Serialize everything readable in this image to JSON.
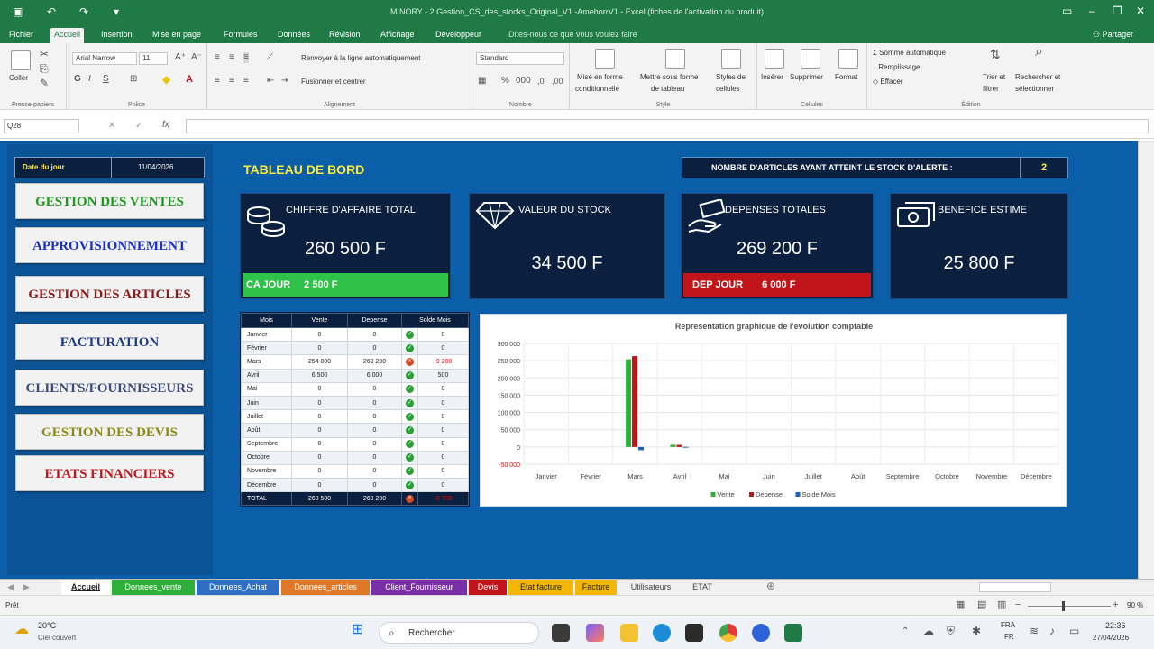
{
  "titlebar": {
    "title": "M NORY - 2 Gestion_CS_des_stocks_Original_V1 -AmehorrV1 - Excel (fiches de l'activation du produit)",
    "share": "Partager"
  },
  "menu": [
    "Fichier",
    "Accueil",
    "Insertion",
    "Mise en page",
    "Formules",
    "Données",
    "Révision",
    "Affichage",
    "Développeur",
    "Dites-nous ce que vous voulez faire"
  ],
  "ribbon": {
    "paste": "Coller",
    "clipboard": "Presse-papiers",
    "font_name": "Arial Narrow",
    "font_size": "11",
    "police": "Police",
    "wrap": "Renvoyer à la ligne automatiquement",
    "merge": "Fusionner et centrer",
    "alignement": "Alignement",
    "number_format": "Standard",
    "nombre": "Nombre",
    "cond_format_1": "Mise en forme",
    "cond_format_2": "conditionnelle",
    "table_format_1": "Mettre sous forme",
    "table_format_2": "de tableau",
    "cell_styles_1": "Styles de",
    "cell_styles_2": "cellules",
    "style": "Style",
    "insert": "Insérer",
    "delete": "Supprimer",
    "format": "Format",
    "cellules": "Cellules",
    "autosum": "Somme automatique",
    "fill": "Remplissage",
    "clear": "Effacer",
    "sort_1": "Trier et",
    "sort_2": "filtrer",
    "find_1": "Rechercher et",
    "find_2": "sélectionner",
    "edition": "Édition"
  },
  "formula": {
    "cell_ref": "Q28",
    "fx": "fx"
  },
  "date": {
    "label": "Date du jour",
    "value": "11/04/2026"
  },
  "nav": [
    {
      "label": "GESTION DES VENTES",
      "color": "#1d9a1d"
    },
    {
      "label": "APPROVISIONNEMENT",
      "color": "#1c2fc4"
    },
    {
      "label": "GESTION DES ARTICLES",
      "color": "#8a1b1b"
    },
    {
      "label": "FACTURATION",
      "color": "#1f3a80"
    },
    {
      "label": "CLIENTS/FOURNISSEURS",
      "color": "#3b4a7a"
    },
    {
      "label": "GESTION DES DEVIS",
      "color": "#8a8a12"
    },
    {
      "label": "ETATS FINANCIERS",
      "color": "#c0141a"
    }
  ],
  "dashboard": {
    "title": "TABLEAU DE BORD",
    "alert_label": "NOMBRE D'ARTICLES AYANT ATTEINT LE STOCK D'ALERTE :",
    "alert_value": "2"
  },
  "cards": {
    "ca": {
      "title": "CHIFFRE D'AFFAIRE TOTAL",
      "value": "260 500 F",
      "bar_label": "CA JOUR",
      "bar_value": "2 500 F"
    },
    "stock": {
      "title": "VALEUR DU STOCK",
      "value": "34 500 F"
    },
    "dep": {
      "title": "DEPENSES TOTALES",
      "value": "269 200 F",
      "bar_label": "DEP JOUR",
      "bar_value": "6 000 F"
    },
    "ben": {
      "title": "BENEFICE ESTIME",
      "value": "25 800 F"
    }
  },
  "table": {
    "headers": [
      "Mois",
      "Vente",
      "Depense",
      "Solde Mois"
    ],
    "rows": [
      [
        "Janvier",
        "0",
        "0",
        "ok",
        "0"
      ],
      [
        "Février",
        "0",
        "0",
        "ok",
        "0"
      ],
      [
        "Mars",
        "254 000",
        "263 200",
        "bad",
        "-9 200"
      ],
      [
        "Avril",
        "6 500",
        "6 000",
        "ok",
        "500"
      ],
      [
        "Mai",
        "0",
        "0",
        "ok",
        "0"
      ],
      [
        "Juin",
        "0",
        "0",
        "ok",
        "0"
      ],
      [
        "Juillet",
        "0",
        "0",
        "ok",
        "0"
      ],
      [
        "Août",
        "0",
        "0",
        "ok",
        "0"
      ],
      [
        "Septembre",
        "0",
        "0",
        "ok",
        "0"
      ],
      [
        "Octobre",
        "0",
        "0",
        "ok",
        "0"
      ],
      [
        "Novembre",
        "0",
        "0",
        "ok",
        "0"
      ],
      [
        "Décembre",
        "0",
        "0",
        "ok",
        "0"
      ]
    ],
    "total": [
      "TOTAL",
      "260 500",
      "269 200",
      "bad",
      "-8 700"
    ]
  },
  "chart_data": {
    "type": "bar",
    "title": "Representation graphique de l'evolution comptable",
    "categories": [
      "Janvier",
      "Février",
      "Mars",
      "Avril",
      "Mai",
      "Juin",
      "Juillet",
      "Août",
      "Septembre",
      "Octobre",
      "Novembre",
      "Décembre"
    ],
    "series": [
      {
        "name": "Vente",
        "color": "#2fae3a",
        "values": [
          0,
          0,
          254000,
          6500,
          0,
          0,
          0,
          0,
          0,
          0,
          0,
          0
        ]
      },
      {
        "name": "Depense",
        "color": "#c0141a",
        "values": [
          0,
          0,
          263200,
          6000,
          0,
          0,
          0,
          0,
          0,
          0,
          0,
          0
        ]
      },
      {
        "name": "Solde Mois",
        "color": "#1f5fb5",
        "values": [
          0,
          0,
          -9200,
          500,
          0,
          0,
          0,
          0,
          0,
          0,
          0,
          0
        ]
      }
    ],
    "ylim": [
      -50000,
      300000
    ],
    "yticks": [
      "300 000",
      "250 000",
      "200 000",
      "150 000",
      "100 000",
      "50 000",
      "0",
      "-50 000"
    ],
    "grid": true,
    "legend": "bottom"
  },
  "tabs": [
    {
      "label": "Accueil",
      "bg": "#ffffff",
      "fg": "#222222"
    },
    {
      "label": "Donnees_vente",
      "bg": "#2fae3a",
      "fg": "#ffffff"
    },
    {
      "label": "Donnees_Achat",
      "bg": "#2e6fc4",
      "fg": "#ffffff"
    },
    {
      "label": "Donnees_articles",
      "bg": "#e0782a",
      "fg": "#ffffff"
    },
    {
      "label": "Client_Fournisseur",
      "bg": "#7a2fa8",
      "fg": "#ffffff"
    },
    {
      "label": "Devis",
      "bg": "#c0141a",
      "fg": "#ffffff"
    },
    {
      "label": "Etat facture",
      "bg": "#f2b705",
      "fg": "#222222"
    },
    {
      "label": "Facture",
      "bg": "#f2b705",
      "fg": "#222222"
    },
    {
      "label": "Utilisateurs",
      "bg": "#f0f0f0",
      "fg": "#444444"
    },
    {
      "label": "ETAT",
      "bg": "#f0f0f0",
      "fg": "#444444"
    }
  ],
  "status": {
    "ready": "Prêt",
    "zoom": "90 %"
  },
  "taskbar": {
    "weather_temp": "20°C",
    "weather_desc": "Ciel couvert",
    "search": "Rechercher",
    "lang_1": "FRA",
    "lang_2": "FR",
    "time": "22:36",
    "date": "27/04/2026"
  }
}
